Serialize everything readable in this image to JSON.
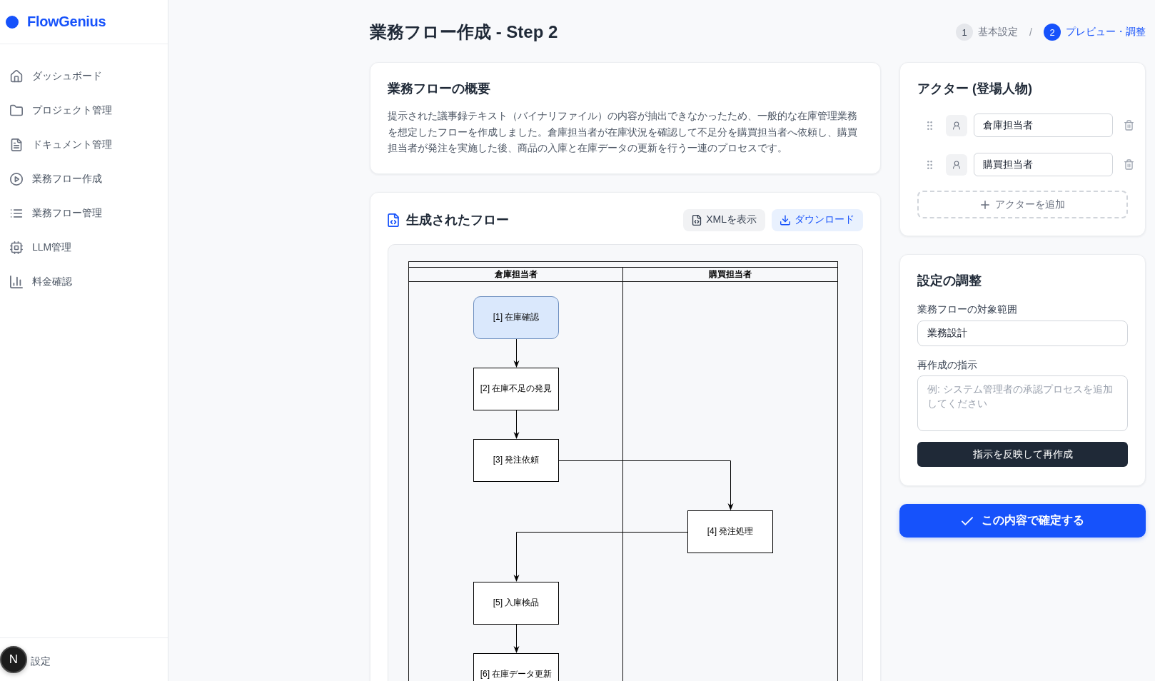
{
  "sidebar": {
    "logo": "FlowGenius",
    "items": [
      {
        "label": "ダッシュボード"
      },
      {
        "label": "プロジェクト管理"
      },
      {
        "label": "ドキュメント管理"
      },
      {
        "label": "業務フロー作成"
      },
      {
        "label": "業務フロー管理"
      },
      {
        "label": "LLM管理"
      },
      {
        "label": "料金確認"
      }
    ],
    "footer_link": "設定",
    "dev_badge": "N"
  },
  "header": {
    "title": "業務フロー作成 - Step 2",
    "steps": [
      {
        "number": "1",
        "label": "基本設定",
        "selected": false
      },
      {
        "number": "2",
        "label": "プレビュー・調整",
        "selected": true
      }
    ],
    "separator": "/"
  },
  "overview": {
    "title": "業務フローの概要",
    "text": "提示された議事録テキスト（バイナリファイル）の内容が抽出できなかったため、一般的な在庫管理業務を想定したフローを作成しました。倉庫担当者が在庫状況を確認して不足分を購買担当者へ依頼し、購買担当者が発注を実施した後、商品の入庫と在庫データの更新を行う一連のプロセスです。"
  },
  "flow": {
    "title": "生成されたフロー",
    "buttons": [
      {
        "label": "XMLを表示",
        "kind": "secondary"
      },
      {
        "label": "ダウンロード",
        "kind": "primary"
      }
    ],
    "diagram": {
      "lanes": [
        {
          "name": "倉庫担当者"
        },
        {
          "name": "購買担当者"
        }
      ],
      "rows": [
        {
          "cells": [
            {
              "kind": "start",
              "label": "[1] 在庫確認"
            },
            {
              "kind": "empty"
            }
          ]
        },
        {
          "cells": [
            {
              "kind": "task",
              "label": "[2] 在庫不足の発見"
            },
            {
              "kind": "empty"
            }
          ]
        },
        {
          "cells": [
            {
              "kind": "task",
              "label": "[3] 発注依頼"
            },
            {
              "kind": "empty"
            }
          ]
        },
        {
          "cells": [
            {
              "kind": "empty"
            },
            {
              "kind": "task",
              "label": "[4] 発注処理"
            }
          ]
        },
        {
          "cells": [
            {
              "kind": "task",
              "label": "[5] 入庫検品"
            },
            {
              "kind": "empty"
            }
          ]
        },
        {
          "cells": [
            {
              "kind": "task",
              "label": "[6] 在庫データ更新"
            },
            {
              "kind": "empty"
            }
          ]
        }
      ]
    }
  },
  "actors": {
    "title": "アクター (登場人物)",
    "items": [
      {
        "name": "倉庫担当者"
      },
      {
        "name": "購買担当者"
      }
    ],
    "add_button": "アクターを追加"
  },
  "settings": {
    "title": "設定の調整",
    "fields": [
      {
        "kind": "input",
        "label": "業務フローの対象範囲",
        "value": "業務設計"
      },
      {
        "kind": "textarea",
        "label": "再作成の指示",
        "placeholder": "例: システム管理者の承認プロセスを追加してください"
      }
    ],
    "button": "指示を反映して再作成"
  },
  "confirm_button": "この内容で確定する"
}
